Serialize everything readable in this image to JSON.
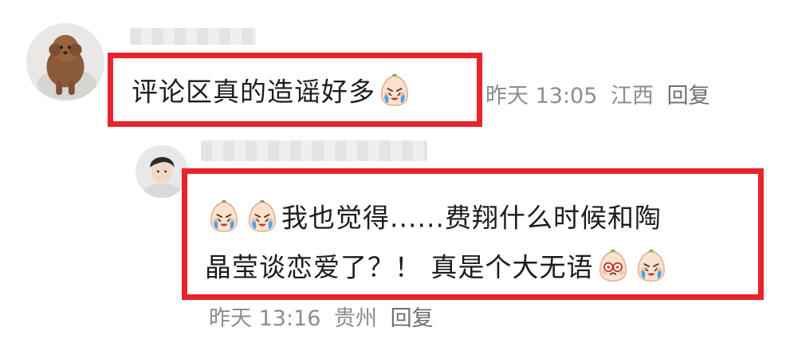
{
  "comments": [
    {
      "text_before": "评论区真的造谣好多",
      "emoji": "crying-face-emoji",
      "time": "昨天 13:05",
      "location": "江西",
      "reply_label": "回复"
    },
    {
      "emoji_lead": [
        "crying-face-emoji",
        "crying-face-emoji"
      ],
      "line1": "我也觉得......费翔什么时候和陶",
      "line2": "晶莹谈恋爱了？！ 真是个大无语",
      "emoji_tail": [
        "shocked-face-emoji",
        "crying-face-emoji"
      ],
      "time": "昨天 13:16",
      "location": "贵州",
      "reply_label": "回复"
    }
  ],
  "colors": {
    "highlight_border": "#e8232c",
    "meta_text": "#8d8d8d",
    "body_text": "#1c1c1c"
  }
}
